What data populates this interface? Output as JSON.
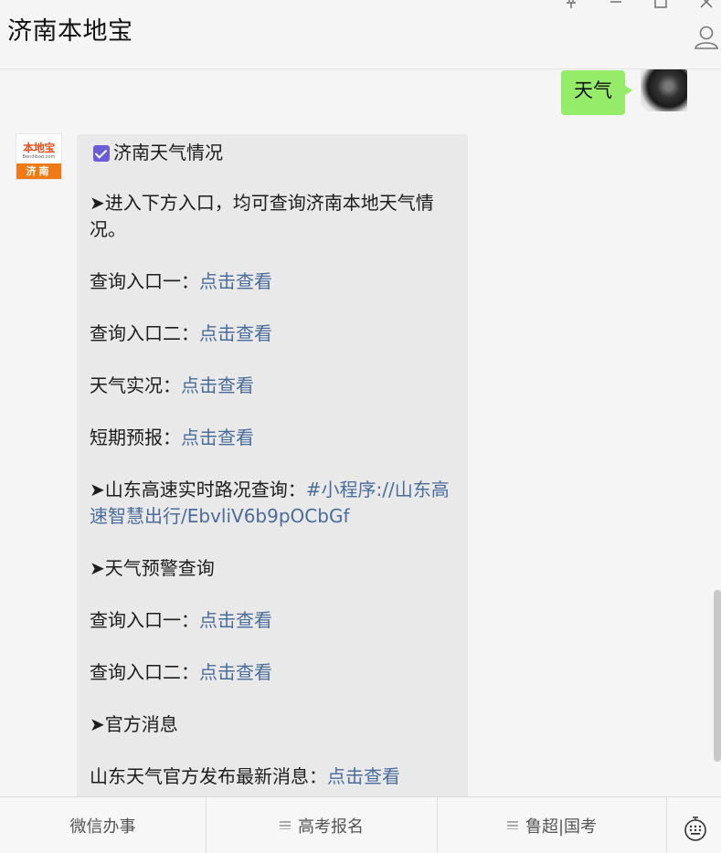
{
  "window": {
    "title": "济南本地宝"
  },
  "chat": {
    "sent_message": "天气",
    "bot_logo": {
      "brand": "本地宝",
      "site": "Bendibao.com",
      "city": "济南"
    },
    "reply": {
      "heading": "济南天气情况",
      "intro": "➤进入下方入口，均可查询济南本地天气情况。",
      "q1_label": "查询入口一：",
      "q1_link": "点击查看",
      "q2_label": "查询入口二：",
      "q2_link": "点击查看",
      "live_label": "天气实况：",
      "live_link": "点击查看",
      "short_label": "短期预报：",
      "short_link": "点击查看",
      "road_label": "➤山东高速实时路况查询：",
      "road_link": "#小程序://山东高速智慧出行/EbvliV6b9pOCbGf",
      "warning_heading": "➤天气预警查询",
      "w1_label": "查询入口一：",
      "w1_link": "点击查看",
      "w2_label": "查询入口二：",
      "w2_link": "点击查看",
      "official_heading": "➤官方消息",
      "news_label": "山东天气官方发布最新消息：",
      "news_link": "点击查看"
    }
  },
  "menu": {
    "items": [
      "微信办事",
      "高考报名",
      "鲁超|国考"
    ]
  },
  "colors": {
    "sent_bubble": "#95ec69",
    "link": "#4a6c9b",
    "checkbox": "#6b5bd8",
    "brand_orange": "#f07b16"
  }
}
